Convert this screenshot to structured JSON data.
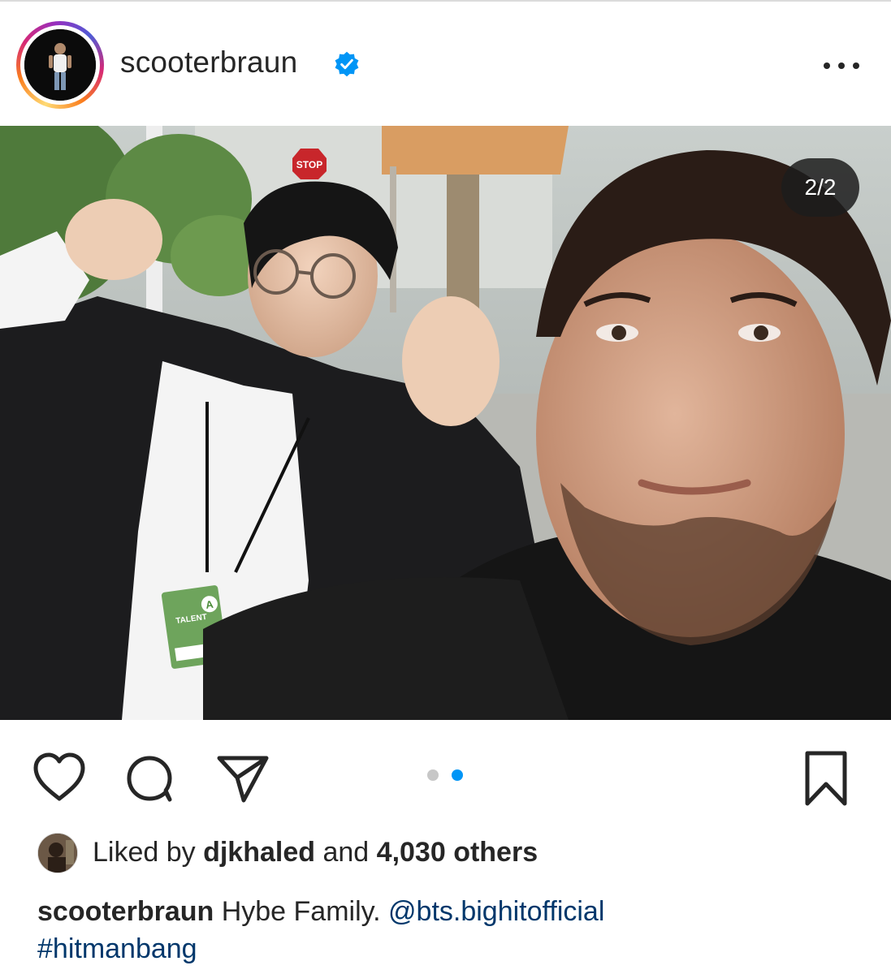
{
  "post": {
    "username": "scooterbraun",
    "image_counter": "2/2",
    "liked_by_prefix": "Liked by",
    "liked_by_user": "djkhaled",
    "liked_by_and": "and",
    "liked_by_others": "4,030 others",
    "caption_username": "scooterbraun",
    "caption_text": "Hybe Family.",
    "caption_mention": "@bts.bighitofficial",
    "caption_hashtag": "#hitmanbang",
    "photo_sign_text": "STOP",
    "photo_badge_text": "TALENT",
    "photo_badge_letter": "A",
    "carousel": {
      "total": 2,
      "current": 2
    }
  },
  "icons": {
    "verified": "verified-badge-icon",
    "more": "more-options-icon",
    "like": "heart-icon",
    "comment": "comment-icon",
    "share": "paper-plane-icon",
    "save": "bookmark-icon"
  },
  "colors": {
    "verified_blue": "#0095f6",
    "carousel_active": "#0095f6",
    "carousel_inactive": "#c7c7c7",
    "link": "#00376b",
    "text": "#262626"
  }
}
